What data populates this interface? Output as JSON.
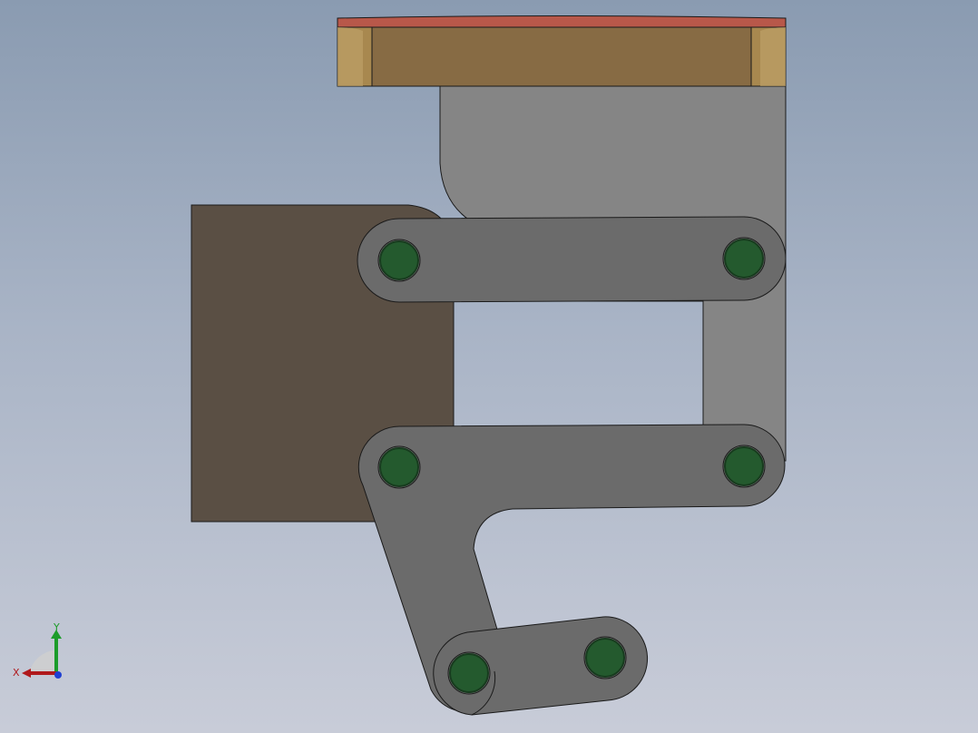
{
  "app": {
    "view": "Front"
  },
  "triad": {
    "x_label": "X",
    "y_label": "Y",
    "x_color": "#b0191c",
    "y_color": "#1c9c2a",
    "z_color": "#1f3fd2"
  },
  "colors": {
    "background_top": "#8a9bb1",
    "background_bottom": "#c8ccd8",
    "top_plate_face": "#876b44",
    "top_plate_edge": "#b89a63",
    "top_plate_rim": "#b8584a",
    "bracket": "#858585",
    "link": "#6b6b6b",
    "block": "#5a4f44",
    "pin": "#245a2e",
    "pin_ring": "#173b1e"
  },
  "model": {
    "parts": [
      "top-plate",
      "bracket",
      "block",
      "upper-link",
      "lower-link",
      "lever-arm",
      "short-link"
    ],
    "pin_count": 6
  }
}
